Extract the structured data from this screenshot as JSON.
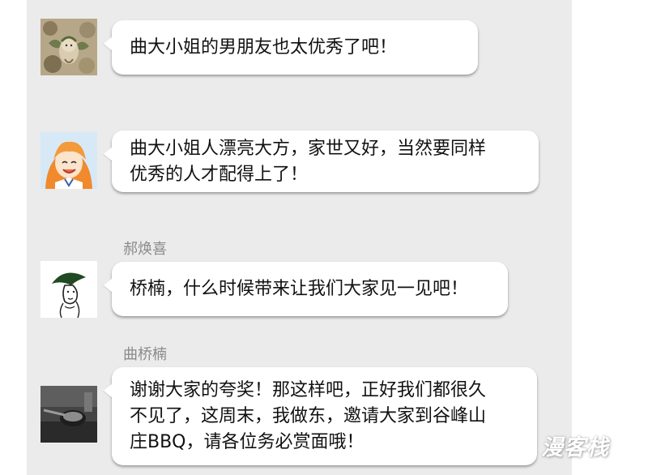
{
  "messages": [
    {
      "sender": "",
      "avatar": "fairy-plant-avatar-icon",
      "lines": [
        "曲大小姐的男朋友也太优秀了吧！"
      ]
    },
    {
      "sender": "",
      "avatar": "orange-hair-girl-avatar-icon",
      "lines": [
        "曲大小姐人漂亮大方，家世又好，当然要同样",
        "优秀的人才配得上了！"
      ]
    },
    {
      "sender": "郝焕喜",
      "avatar": "sketch-character-avatar-icon",
      "lines": [
        "桥楠，什么时候带来让我们大家见一见吧！"
      ]
    },
    {
      "sender": "曲桥楠",
      "avatar": "dark-photo-avatar-icon",
      "lines": [
        "谢谢大家的夸奖！那这样吧，正好我们都很久",
        "不见了，这周末，我做东，邀请大家到谷峰山",
        "庄BBQ，请各位务必赏面哦！"
      ]
    }
  ],
  "watermark": "漫客栈",
  "colors": {
    "chat_background": "#ebebeb",
    "bubble": "#ffffff",
    "sender_name": "#8a8a8a"
  }
}
